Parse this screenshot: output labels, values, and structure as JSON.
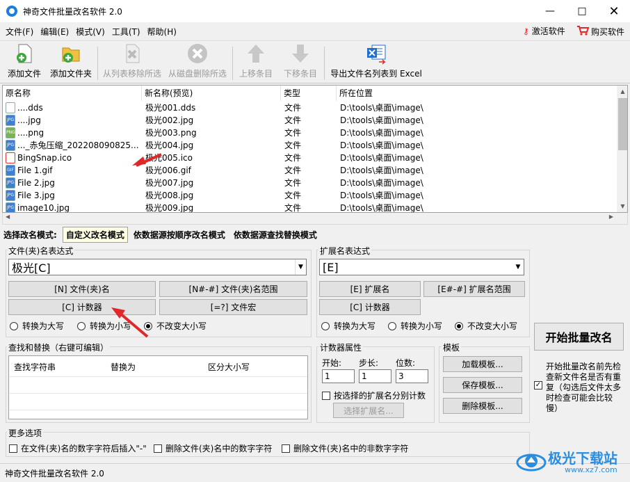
{
  "window": {
    "title": "神奇文件批量改名软件 2.0"
  },
  "menu": [
    "文件(F)",
    "编辑(E)",
    "模式(V)",
    "工具(T)",
    "帮助(H)"
  ],
  "right_menu": {
    "activate": "激活软件",
    "buy": "购买软件"
  },
  "toolbar": {
    "add_file": "添加文件",
    "add_folder": "添加文件夹",
    "remove_from_list": "从列表移除所选",
    "delete_from_disk": "从磁盘删除所选",
    "move_up": "上移条目",
    "move_down": "下移条目",
    "export_excel": "导出文件名列表到 Excel"
  },
  "file_list": {
    "columns": [
      "原名称",
      "新名称(预览)",
      "类型",
      "所在位置"
    ],
    "rows": [
      {
        "icon": "file",
        "name": "....dds",
        "new": "极光001.dds",
        "type": "文件",
        "loc": "D:\\tools\\桌面\\image\\"
      },
      {
        "icon": "jpg",
        "name": "....jpg",
        "new": "极光002.jpg",
        "type": "文件",
        "loc": "D:\\tools\\桌面\\image\\"
      },
      {
        "icon": "png",
        "name": "....png",
        "new": "极光003.png",
        "type": "文件",
        "loc": "D:\\tools\\桌面\\image\\"
      },
      {
        "icon": "jpg",
        "name": "..._赤兔压缩_202208090825...",
        "new": "极光004.jpg",
        "type": "文件",
        "loc": "D:\\tools\\桌面\\image\\"
      },
      {
        "icon": "ico",
        "name": "BingSnap.ico",
        "new": "极光005.ico",
        "type": "文件",
        "loc": "D:\\tools\\桌面\\image\\"
      },
      {
        "icon": "gif",
        "name": "File 1.gif",
        "new": "极光006.gif",
        "type": "文件",
        "loc": "D:\\tools\\桌面\\image\\"
      },
      {
        "icon": "jpg",
        "name": "File 2.jpg",
        "new": "极光007.jpg",
        "type": "文件",
        "loc": "D:\\tools\\桌面\\image\\"
      },
      {
        "icon": "jpg",
        "name": "File 3.jpg",
        "new": "极光008.jpg",
        "type": "文件",
        "loc": "D:\\tools\\桌面\\image\\"
      },
      {
        "icon": "jpg",
        "name": "image10.jpg",
        "new": "极光009.jpg",
        "type": "文件",
        "loc": "D:\\tools\\桌面\\image\\"
      }
    ]
  },
  "mode": {
    "label": "选择改名模式:",
    "tabs": [
      "自定义改名模式",
      "依数据源按顺序改名模式",
      "依数据源查找替换模式"
    ]
  },
  "name_expr": {
    "label": "文件(夹)名表达式",
    "value": "极光[C]",
    "btn_n": "[N] 文件(夹)名",
    "btn_range": "[N#-#] 文件(夹)名范围",
    "btn_c": "[C] 计数器",
    "btn_macro": "[=?] 文件宏",
    "radio_upper": "转换为大写",
    "radio_lower": "转换为小写",
    "radio_keep": "不改变大小写"
  },
  "ext_expr": {
    "label": "扩展名表达式",
    "value": "[E]",
    "btn_e": "[E] 扩展名",
    "btn_range": "[E#-#] 扩展名范围",
    "btn_c": "[C] 计数器",
    "radio_upper": "转换为大写",
    "radio_lower": "转换为小写",
    "radio_keep": "不改变大小写"
  },
  "start_button": "开始批量改名",
  "find_replace": {
    "label": "查找和替换（右键可编辑）",
    "columns": [
      "查找字符串",
      "替换为",
      "区分大小写"
    ]
  },
  "counter": {
    "label": "计数器属性",
    "start_label": "开始:",
    "step_label": "步长:",
    "digits_label": "位数:",
    "start": "1",
    "step": "1",
    "digits": "3",
    "per_ext": "按选择的扩展名分别计数",
    "choose_ext": "选择扩展名..."
  },
  "template": {
    "label": "模板",
    "load": "加载模板...",
    "save": "保存模板...",
    "delete": "删除模板..."
  },
  "precheck": "开始批量改名前先检查新文件名是否有重复（勾选后文件太多时检查可能会比较慢）",
  "more_options": {
    "label": "更多选项",
    "opt1": "在文件(夹)名的数字字符后插入\"-\"",
    "opt2": "删除文件(夹)名中的数字字符",
    "opt3": "删除文件(夹)名中的非数字字符"
  },
  "status": "神奇文件批量改名软件 2.0",
  "watermark": "极光下载站 www.xz7.com",
  "colors": {
    "accent": "#1a7de0",
    "arrow": "#e0282b",
    "selected_tab": "#ffffe1"
  }
}
